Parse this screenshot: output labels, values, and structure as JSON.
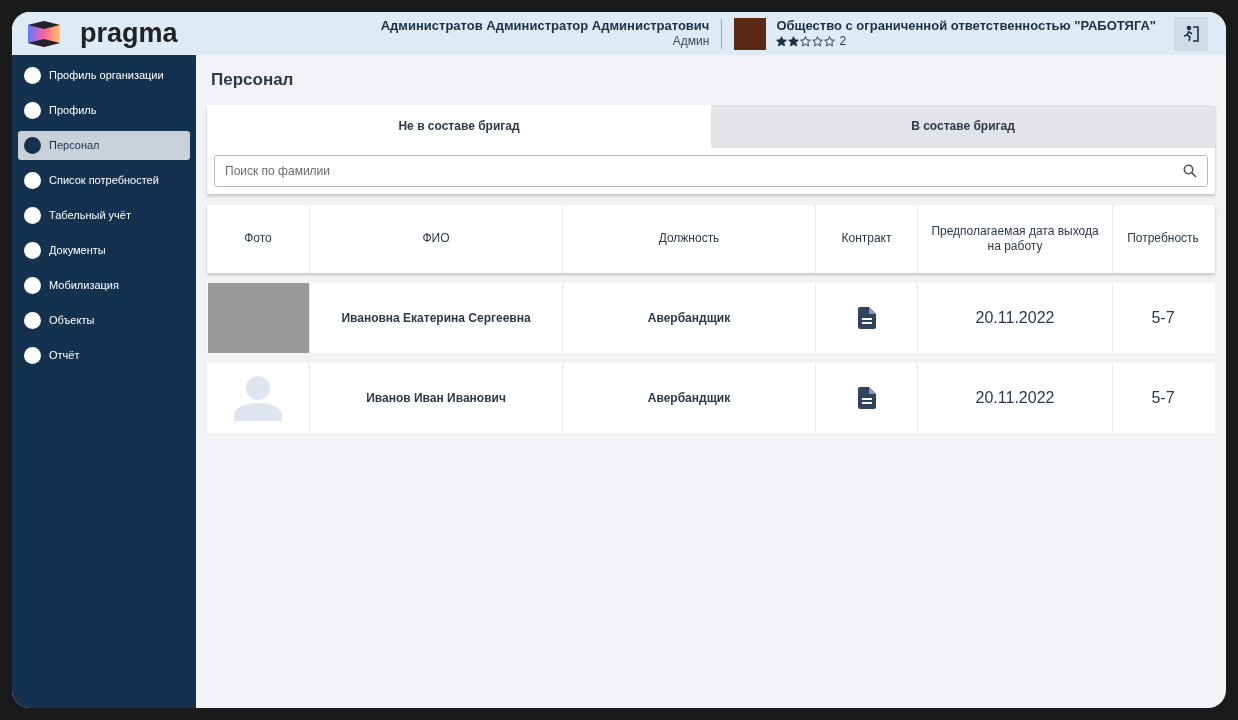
{
  "header": {
    "logo": "pragma",
    "user": {
      "name": "Администратов Администратор Администратович",
      "role": "Админ"
    },
    "organization": {
      "name": "Общество с ограниченной ответственностью \"РАБОТЯГА\"",
      "stars": 2,
      "rating": "2"
    }
  },
  "sidebar": {
    "items": [
      {
        "label": "Профиль организации",
        "selected": false
      },
      {
        "label": "Профиль",
        "selected": false
      },
      {
        "label": "Персонал",
        "selected": true
      },
      {
        "label": "Список потребностей",
        "selected": false
      },
      {
        "label": "Табельный учёт",
        "selected": false
      },
      {
        "label": "Документы",
        "selected": false
      },
      {
        "label": "Мобилизация",
        "selected": false
      },
      {
        "label": "Объекты",
        "selected": false
      },
      {
        "label": "Отчёт",
        "selected": false
      }
    ]
  },
  "page_title": "Персонал",
  "tabs": [
    {
      "label": "Не в составе бригад",
      "selected": true
    },
    {
      "label": "В составе бригад",
      "selected": false
    }
  ],
  "search": {
    "placeholder": "Поиск по фамилии"
  },
  "table": {
    "columns": [
      "Фото",
      "ФИО",
      "Должность",
      "Контракт",
      "Предполагаемая дата выхода на работу",
      "Потребность"
    ],
    "rows": [
      {
        "kind": "photo",
        "name": "Ивановна Екатерина Сергеевна",
        "position": "Авербандщик",
        "date": "20.11.2022",
        "need": "5-7"
      },
      {
        "kind": "placeholder",
        "name": "Иванов Иван Иванович",
        "position": "Авербандщик",
        "date": "20.11.2022",
        "need": "5-7"
      }
    ]
  }
}
